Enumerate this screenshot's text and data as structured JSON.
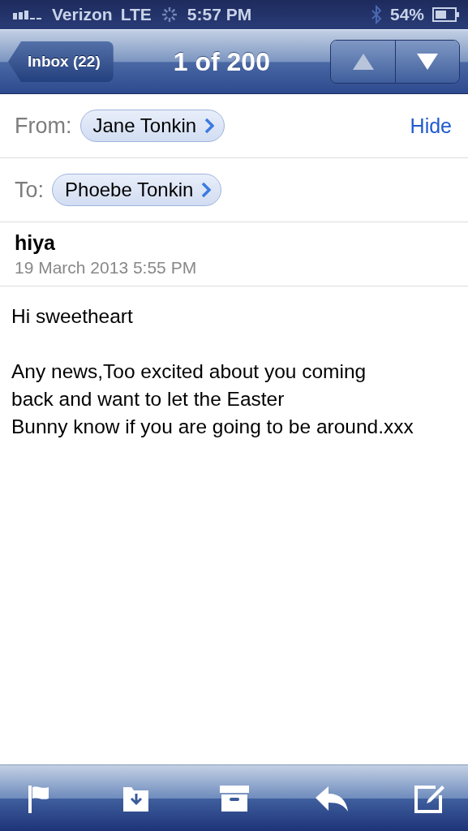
{
  "status_bar": {
    "carrier": "Verizon",
    "network": "LTE",
    "time": "5:57 PM",
    "battery": "54%"
  },
  "nav_bar": {
    "back_button": "Inbox (22)",
    "title": "1 of 200",
    "previous_disabled": true,
    "next_disabled": false
  },
  "header": {
    "from_label": "From:",
    "from": "Jane Tonkin",
    "hide_link": "Hide",
    "to_label": "To:",
    "to": "Phoebe Tonkin",
    "subject": "hiya",
    "date": "19 March 2013 5:55 PM"
  },
  "body": [
    "Hi sweetheart",
    "Any news,Too excited about you coming\nback and want to let the Easter\nBunny know if you are going to be around.xxx"
  ]
}
